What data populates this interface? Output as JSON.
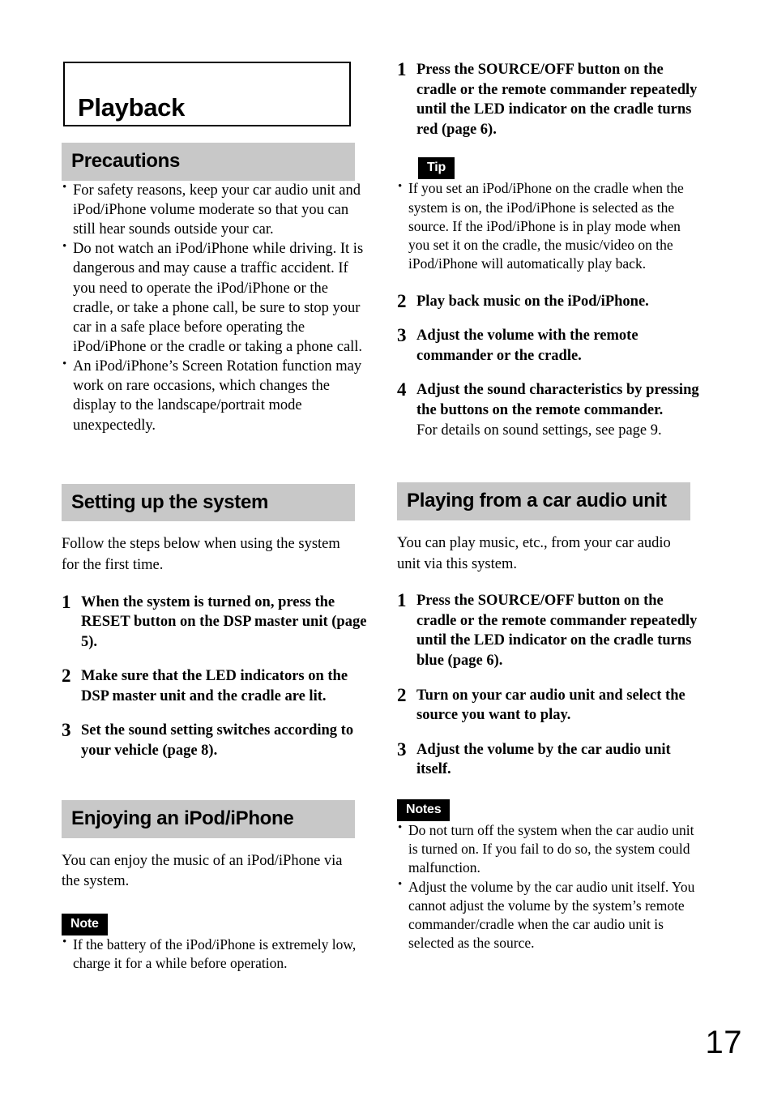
{
  "page": {
    "number": "17",
    "title": "Playback",
    "theme": {
      "section_header_bg": "#c8c8c8",
      "badge_bg": "#000000",
      "badge_fg": "#ffffff",
      "text": "#000000",
      "page_bg": "#ffffff"
    }
  },
  "left_column": {
    "precautions": {
      "heading": "Precautions",
      "bullets": [
        "For safety reasons, keep your car audio unit and iPod/iPhone volume moderate so that you can still hear sounds outside your car.",
        "Do not watch an iPod/iPhone while driving. It is dangerous and may cause a traffic accident. If you need to operate the iPod/iPhone or the cradle, or take a phone call, be sure to stop your car in a safe place before operating the iPod/iPhone or the cradle or taking a phone call.",
        "An iPod/iPhone’s Screen Rotation function may work on rare occasions, which changes the display to the landscape/portrait mode unexpectedly."
      ]
    },
    "setting_up": {
      "heading": "Setting up the system",
      "intro": "Follow the steps below when using the system for the first time.",
      "steps": [
        {
          "num": "1",
          "text": "When the system is turned on, press the RESET button on the DSP master unit (page 5)."
        },
        {
          "num": "2",
          "text": "Make sure that the LED indicators on the DSP master unit and the cradle are lit."
        },
        {
          "num": "3",
          "text": "Set the sound setting switches according to your vehicle (page 8)."
        }
      ]
    },
    "enjoying": {
      "heading": "Enjoying an iPod/iPhone",
      "intro": "You can enjoy the music of an iPod/iPhone via the system.",
      "note_badge": "Note",
      "note_bullets": [
        "If the battery of the iPod/iPhone is extremely low, charge it for a while before operation."
      ]
    }
  },
  "right_column": {
    "enjoying_steps": {
      "step1": {
        "num": "1",
        "text": "Press the SOURCE/OFF button on the cradle or the remote commander repeatedly until the LED indicator on the cradle turns red (page 6)."
      },
      "tip_badge": "Tip",
      "tip_bullets": [
        "If you set an iPod/iPhone on the cradle when the system is on, the iPod/iPhone is selected as the source. If the iPod/iPhone is in play mode when you set it on the cradle, the music/video on the iPod/iPhone will automatically play back."
      ],
      "steps": [
        {
          "num": "2",
          "text": "Play back music on the iPod/iPhone.",
          "sub": ""
        },
        {
          "num": "3",
          "text": "Adjust the volume with the remote commander or the cradle.",
          "sub": ""
        },
        {
          "num": "4",
          "text": "Adjust the sound characteristics by pressing the buttons on the remote commander.",
          "sub": "For details on sound settings, see page 9."
        }
      ]
    },
    "car_audio": {
      "heading": "Playing from a car audio unit",
      "intro": "You can play music, etc., from your car audio unit via this system.",
      "steps": [
        {
          "num": "1",
          "text": "Press the SOURCE/OFF button on the cradle or the remote commander repeatedly until the LED indicator on the cradle turns blue (page 6)."
        },
        {
          "num": "2",
          "text": "Turn on your car audio unit and select the source you want to play."
        },
        {
          "num": "3",
          "text": "Adjust the volume by the car audio unit itself."
        }
      ],
      "notes_badge": "Notes",
      "notes_bullets": [
        "Do not turn off the system when the car audio unit is turned on. If you fail to do so, the system could malfunction.",
        "Adjust the volume by the car audio unit itself. You cannot adjust the volume by the system’s remote commander/cradle when the car audio unit is selected as the source."
      ]
    }
  }
}
